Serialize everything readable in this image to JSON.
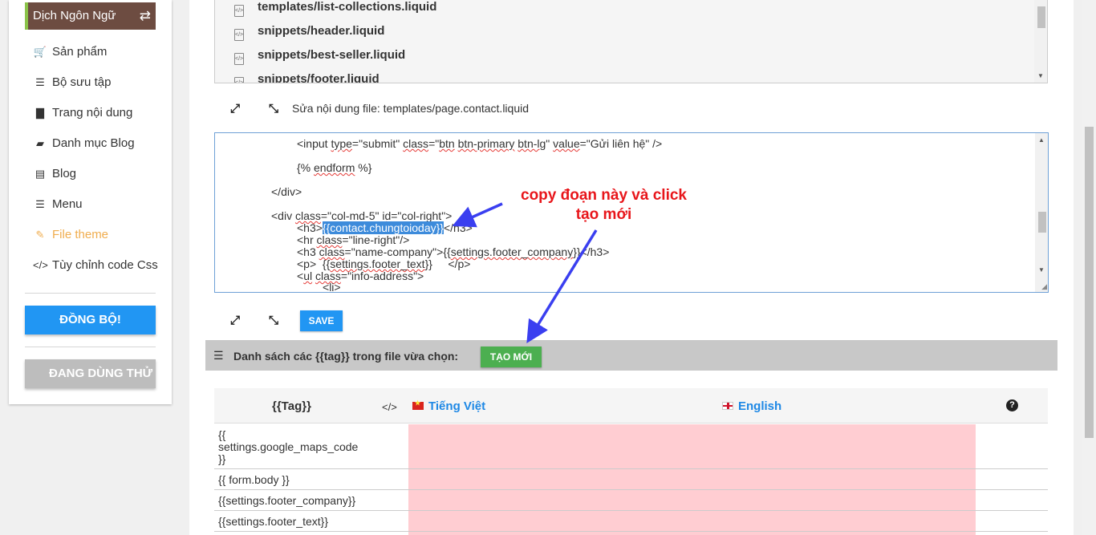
{
  "sidebar": {
    "language_label": "Dịch Ngôn Ngữ",
    "swap_icon": "⇄",
    "items": [
      {
        "label": "Sản phẩm",
        "icon": "🛒"
      },
      {
        "label": "Bộ sưu tập",
        "icon": "☰"
      },
      {
        "label": "Trang nội dung",
        "icon": "▇"
      },
      {
        "label": "Danh mục Blog",
        "icon": "▰"
      },
      {
        "label": "Blog",
        "icon": "▤"
      },
      {
        "label": "Menu",
        "icon": "☰"
      },
      {
        "label": "File theme",
        "icon": "✎"
      },
      {
        "label": "Tùy chỉnh code Css",
        "icon": "</>"
      }
    ],
    "sync_label": "ĐỒNG BỘ!",
    "trial_label": "ĐANG DÙNG THỬ"
  },
  "files": {
    "items": [
      "templates/list-collections.liquid",
      "snippets/header.liquid",
      "snippets/best-seller.liquid",
      "snippets/footer.liquid"
    ]
  },
  "editor": {
    "title": "Sửa nội dung file: templates/page.contact.liquid",
    "save_label": "SAVE",
    "lines": {
      "l1a": "<input ",
      "l1b": "type",
      "l1c": "=\"submit\" ",
      "l1d": "class",
      "l1e": "=\"",
      "l1f": "btn",
      "l1g": " ",
      "l1h": "btn-primary",
      "l1i": " ",
      "l1j": "btn-lg",
      "l1k": "\" ",
      "l1l": "value",
      "l1m": "=\"Gửi liên hệ\" />",
      "l2a": "{% ",
      "l2b": "endform",
      "l2c": " %}",
      "l3": "</div>",
      "l4a": "<div ",
      "l4b": "class",
      "l4c": "=\"col-md-5\" ",
      "l4d": "id",
      "l4e": "=\"col-right\">",
      "l5a": "<h3>",
      "l5b": "{{contact.chungtoioday}}",
      "l5c": "</h3>",
      "l6a": "<hr ",
      "l6b": "class",
      "l6c": "=\"line-right\"/>",
      "l7a": "<h3 ",
      "l7b": "class",
      "l7c": "=\"name-company\">{{",
      "l7d": "settings.footer_company",
      "l7e": "}}</h3>",
      "l8a": "<p>  {{",
      "l8b": "settings.footer_text",
      "l8c": "}}     </p>",
      "l9a": "<",
      "l9b": "ul",
      "l9c": " ",
      "l9d": "class",
      "l9e": "=\"info-address\">",
      "l10a": "<",
      "l10b": "li",
      "l10c": ">"
    }
  },
  "tag_section": {
    "title": "Danh sách các {{tag}} trong file vừa chọn:",
    "new_label": "TẠO MỚI"
  },
  "table": {
    "col_tag": "{{Tag}}",
    "col_code_icon": "</>",
    "col_vi": "Tiếng Việt",
    "col_en": "English",
    "help_icon": "?",
    "rows": [
      {
        "tag_l1": "{{",
        "tag_l2": "settings.google_maps_code",
        "tag_l3": "}}"
      },
      {
        "tag": "{{ form.body }}"
      },
      {
        "tag": "{{settings.footer_company}}"
      },
      {
        "tag": "{{settings.footer_text}}"
      }
    ]
  },
  "annotation": {
    "line1": "copy đoạn này và click",
    "line2": "tạo mới"
  },
  "colors": {
    "sidebar_lang_bg": "#6d4c41",
    "primary_blue": "#2196f3",
    "create_green": "#4caf50",
    "annotation_red": "#e8161b",
    "arrow_blue": "#3a3ff0",
    "pink_cell": "#ffcdd2"
  }
}
